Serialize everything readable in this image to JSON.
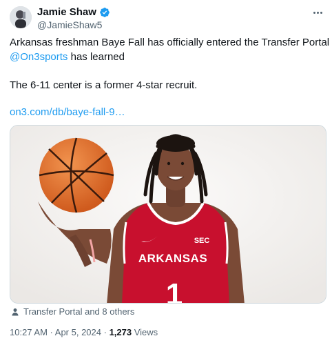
{
  "author": {
    "name": "Jamie Shaw",
    "handle": "@JamieShaw5",
    "verified_color": "#1d9bf0"
  },
  "tweet": {
    "line1": "Arkansas freshman Baye Fall has officially entered the Transfer Portal",
    "mention": "@On3sports",
    "line2_rest": " has learned",
    "line3": "The 6-11 center is a former 4-star recruit.",
    "link": "on3.com/db/baye-fall-9…"
  },
  "media": {
    "jersey_text": "ARKANSAS",
    "jersey_number": "1",
    "badge_text": "SEC",
    "jersey_color": "#c8102e"
  },
  "tagged": {
    "icon": "person-icon",
    "label": "Transfer Portal and 8 others"
  },
  "meta": {
    "time": "10:27 AM",
    "sep1": " · ",
    "date": "Apr 5, 2024",
    "sep2": " · ",
    "views": "1,273",
    "views_label": " Views"
  },
  "icons": {
    "more": "more-icon",
    "verified": "verified-badge-icon"
  }
}
